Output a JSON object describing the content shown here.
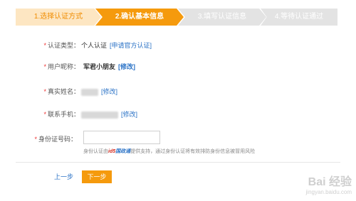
{
  "steps": [
    {
      "label": "1.选择认证方式"
    },
    {
      "label": "2.确认基本信息"
    },
    {
      "label": "3.填写认证信息"
    },
    {
      "label": "4.等待认证通过"
    }
  ],
  "form": {
    "cert_type": {
      "label": "认证类型：",
      "value": "个人认证",
      "link": "[申请官方认证]"
    },
    "nickname": {
      "label": "用户昵称：",
      "value": "军君小朋友",
      "link": "[修改]"
    },
    "realname": {
      "label": "真实姓名：",
      "link": "[修改]"
    },
    "phone": {
      "label": "联系手机：",
      "link": "[修改]"
    },
    "id_number": {
      "label": "身份证号码：",
      "value": ""
    },
    "required_mark": "*",
    "hint_prefix": "身份认证由",
    "hint_brand": "id5",
    "hint_brand_b": "国政通",
    "hint_suffix": "提供支持，通过身份认证将有效排防身份信息被冒用风险"
  },
  "actions": {
    "prev": "上一步",
    "next": "下一步"
  },
  "watermark": {
    "title": "Bai 经验",
    "url": "jingyan.baidu.com"
  },
  "colors": {
    "accent": "#f59a0d",
    "link": "#2a72c6",
    "required": "#e33333"
  }
}
